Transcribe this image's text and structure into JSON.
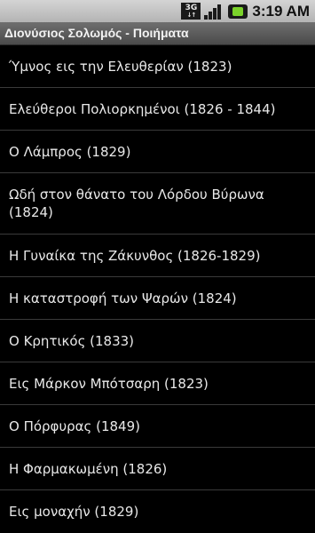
{
  "status_bar": {
    "network_label": "3G",
    "time": "3:19",
    "ampm": "AM"
  },
  "title_bar": {
    "title": "Διονύσιος Σολωμός - Ποιήματα"
  },
  "poems": [
    "Ύμνος εις την Ελευθερίαν (1823)",
    "Ελεύθεροι Πολιορκημένοι (1826 - 1844)",
    "Ο Λάμπρος (1829)",
    "Ωδή στον θάνατο του Λόρδου Βύρωνα (1824)",
    "Η Γυναίκα της Ζάκυνθος (1826-1829)",
    "Η καταστροφή των Ψαρών (1824)",
    "Ο Κρητικός (1833)",
    "Εις Μάρκον Μπότσαρη (1823)",
    "Ο Πόρφυρας (1849)",
    "Η Φαρμακωμένη (1826)",
    "Εις μοναχήν (1829)"
  ]
}
